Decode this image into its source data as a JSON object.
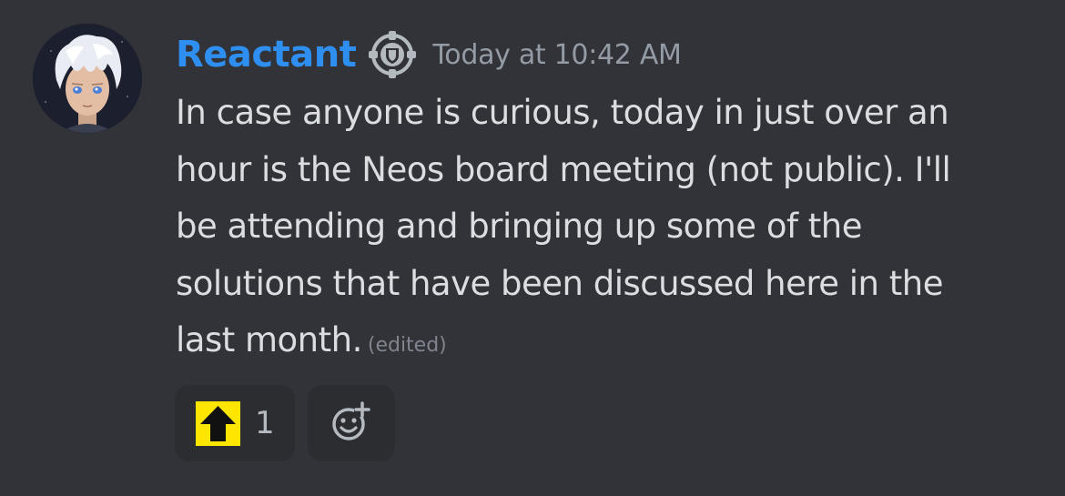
{
  "message": {
    "author": "Reactant",
    "timestamp": "Today at 10:42 AM",
    "content_lines": [
      "In case anyone is curious, today in just over an",
      "hour is the Neos board meeting (not public). I'll",
      "be attending and bringing up some of the",
      "solutions that have been discussed here in the",
      "last month."
    ],
    "edited_label": "(edited)",
    "author_color": "#2e8ff0",
    "badge_icon": "moderator-shield-icon"
  },
  "reactions": [
    {
      "emoji": "up-arrow-emoji",
      "emoji_color": "#ffe600",
      "count": "1"
    }
  ],
  "add_reaction": {
    "icon": "add-reaction-icon"
  }
}
